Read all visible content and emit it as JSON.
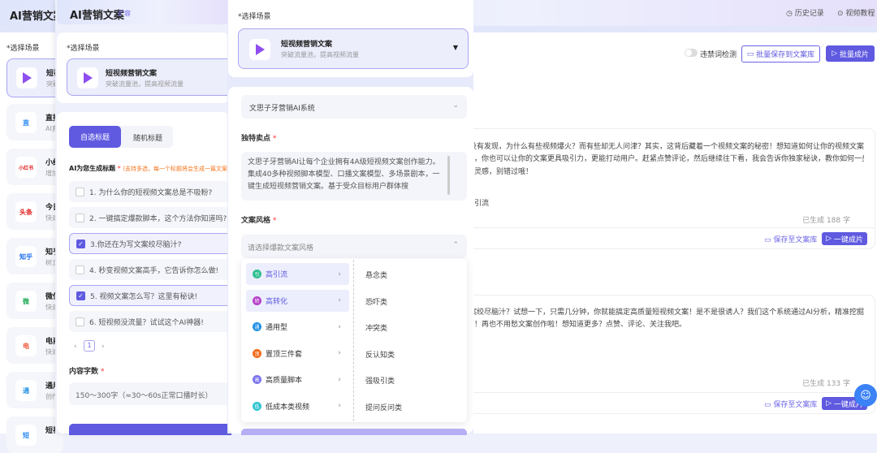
{
  "app": {
    "title": "AI营销文案",
    "history": "历史记录",
    "tutorial": "视频教程"
  },
  "back_sidebar": {
    "label": "*选择场景",
    "items": [
      {
        "icon": "短",
        "t": "短视",
        "s": "突破"
      },
      {
        "icon": "直",
        "t": "直播",
        "s": "AI直"
      },
      {
        "icon": "小红书",
        "t": "小红",
        "s": "增加"
      },
      {
        "icon": "头条",
        "t": "今日",
        "s": "快速"
      },
      {
        "icon": "知乎",
        "t": "知乎",
        "s": "树立"
      },
      {
        "icon": "微",
        "t": "微信",
        "s": "快速"
      },
      {
        "icon": "电",
        "t": "电商",
        "s": "快速"
      },
      {
        "icon": "通",
        "t": "通用",
        "s": "创作"
      },
      {
        "icon": "短",
        "t": "短视",
        "s": ""
      }
    ]
  },
  "toolbar": {
    "toggle_label": "违禁词检测",
    "save_all": "批量保存到文案库",
    "batch_video": "批量成片"
  },
  "results": [
    {
      "lines": [
        "有没有发现，为什么有些视频爆火？而有些却无人问津？其实，这背后藏着一个视频文案的秘密！想知道如何让你的视频文案",
        "，你也可以让你的文案更具吸引力，更能打动用户。赶紧点赞评论，然后继续往下看，我会告诉你独家秘诀，教你如何一步步",
        "灵感，别错过哦！"
      ],
      "tag": "引流",
      "count": "已生成 188 字",
      "save": "保存至文案库",
      "video": "一键成片"
    },
    {
      "lines": [
        "文案绞尽脑汁？试想一下，只需几分钟，你就能搞定高质量短视频文案！是不是很诱人？我们这个系统通过AI分析，精准挖掘",
        "。再也不用愁文案创作啦！想知道更多？点赞、评论、关注我吧！"
      ],
      "count": "已生成 133 字",
      "save": "保存至文案库",
      "video": "一键成片"
    }
  ],
  "mid": {
    "title": "AI营销文案",
    "expand": "扩容",
    "scene_label": "*选择场景",
    "scene_name": "短视频营销文案",
    "scene_desc": "突破流量池，提高视频流量",
    "tabs": [
      "自选标题",
      "随机标题"
    ],
    "gen_label": "AI为您生成标题",
    "gen_hint": "(支持多选，每一个标题将会生成一篇文案)",
    "titles": [
      {
        "t": "1. 为什么你的短视频文案总是不吸粉?",
        "c": false
      },
      {
        "t": "2. 一键搞定爆款脚本，这个方法你知道吗?",
        "c": false
      },
      {
        "t": "3.你还在为写文案绞尽脑汁?",
        "c": true
      },
      {
        "t": "4. 秒变视频文案高手，它告诉你怎么做!",
        "c": false
      },
      {
        "t": "5. 视频文案怎么写？这里有秘诀!",
        "c": true
      },
      {
        "t": "6. 短视频没流量？试试这个AI神器!",
        "c": false
      }
    ],
    "page": "1",
    "count_label": "内容字数",
    "count_value": "150～300字（≈30～60s正常口播时长）"
  },
  "front": {
    "scene_label": "*选择场景",
    "scene_name": "短视频营销文案",
    "scene_desc": "突破流量池，提高视频流量",
    "brand": "文思子牙营销AI系统",
    "usp_label": "独特卖点",
    "usp": "文思子牙营销AI让每个企业拥有4A级短视频文案创作能力。集成40多种视频脚本模型、口播文案模型、多场景剧本，一键生成短视频营销文案。基于受众目标用户群体搜",
    "style_label": "文案风格",
    "style_placeholder": "请选择爆款文案风格",
    "categories": [
      {
        "n": "高引流",
        "i": "引",
        "c": "#2fbf8f"
      },
      {
        "n": "高转化",
        "i": "转",
        "c": "#b640c8"
      },
      {
        "n": "通用型",
        "i": "通",
        "c": "#1e8fe6"
      },
      {
        "n": "置顶三件套",
        "i": "顶",
        "c": "#f26a1b"
      },
      {
        "n": "高质量脚本",
        "i": "高",
        "c": "#7b74ee"
      },
      {
        "n": "低成本类视频",
        "i": "低",
        "c": "#2fc3cf"
      }
    ],
    "styles": [
      "悬念类",
      "恐吓类",
      "冲突类",
      "反认知类",
      "强吸引类",
      "提问反问类"
    ]
  }
}
